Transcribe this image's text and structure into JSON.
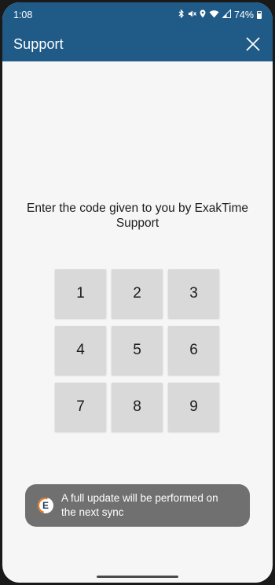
{
  "status_bar": {
    "time": "1:08",
    "battery": "74%",
    "icons": [
      "bluetooth-icon",
      "mute-icon",
      "location-icon",
      "wifi-icon",
      "signal-icon",
      "battery-icon"
    ]
  },
  "app_bar": {
    "title": "Support",
    "close_icon": "close-icon"
  },
  "prompt": {
    "line1": "Enter the code given to you by ExakTime",
    "line2": "Support"
  },
  "keypad": {
    "keys": [
      "1",
      "2",
      "3",
      "4",
      "5",
      "6",
      "7",
      "8",
      "9"
    ]
  },
  "toast": {
    "icon": "exaktime-logo-icon",
    "icon_letter": "E",
    "line1": "A full update will be performed on",
    "line2": "the next sync"
  },
  "colors": {
    "header": "#205a87",
    "background": "#f6f6f6",
    "key": "#d8d9d8",
    "toast": "#707070",
    "accent": "#e37b1d"
  }
}
